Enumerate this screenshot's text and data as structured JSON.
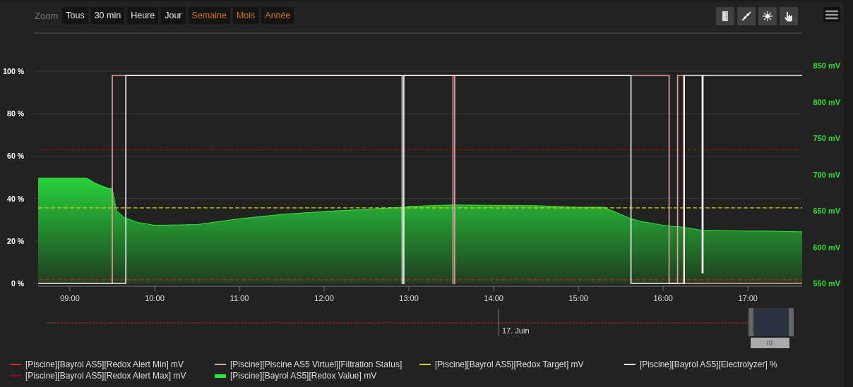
{
  "zoom": {
    "label": "Zoom",
    "buttons": [
      {
        "label": "Tous",
        "disabled": false
      },
      {
        "label": "30 min",
        "disabled": false
      },
      {
        "label": "Heure",
        "disabled": false
      },
      {
        "label": "Jour",
        "disabled": false
      },
      {
        "label": "Semaine",
        "disabled": true
      },
      {
        "label": "Mois",
        "disabled": true
      },
      {
        "label": "Année",
        "disabled": true
      }
    ]
  },
  "tools": [
    {
      "kind": "ruler"
    },
    {
      "kind": "line"
    },
    {
      "kind": "asterisk"
    },
    {
      "kind": "hand"
    }
  ],
  "chart": {
    "chart_data": {
      "type": "line",
      "grid": true,
      "x": [
        8.625,
        9.2,
        9.3,
        9.45,
        9.5,
        9.5,
        9.55,
        9.65,
        9.66,
        9.66,
        9.8,
        10,
        10.5,
        11,
        11.5,
        12,
        12.5,
        12.92,
        12.92,
        12.94,
        12.94,
        13,
        13.5,
        13.52,
        13.52,
        13.54,
        13.54,
        14.5,
        15,
        15.3,
        15.5,
        15.62,
        15.62,
        15.75,
        16,
        16.07,
        16.07,
        16.17,
        16.17,
        16.2,
        16.24,
        16.24,
        16.25,
        16.25,
        16.46,
        16.46,
        16.47,
        16.47,
        16.5,
        17,
        17.2,
        17.64
      ],
      "xlim": [
        8.625,
        17.64
      ],
      "xticks": [
        {
          "value": 9,
          "label": "09:00"
        },
        {
          "value": 10,
          "label": "10:00"
        },
        {
          "value": 11,
          "label": "11:00"
        },
        {
          "value": 12,
          "label": "12:00"
        },
        {
          "value": 13,
          "label": "13:00"
        },
        {
          "value": 14,
          "label": "14:00"
        },
        {
          "value": 15,
          "label": "15:00"
        },
        {
          "value": 16,
          "label": "16:00"
        },
        {
          "value": 17,
          "label": "17:00"
        }
      ],
      "ylim": [
        0,
        100
      ],
      "yticks": [
        {
          "value": 0,
          "label": "0 %"
        },
        {
          "value": 20,
          "label": "20 %"
        },
        {
          "value": 40,
          "label": "40 %"
        },
        {
          "value": 60,
          "label": "60 %"
        },
        {
          "value": 80,
          "label": "80 %"
        },
        {
          "value": 100,
          "label": "100 %"
        }
      ],
      "y2lim": [
        550,
        850
      ],
      "y2ticks": [
        {
          "value": 550,
          "label": "550 mV"
        },
        {
          "value": 600,
          "label": "600 mV"
        },
        {
          "value": 650,
          "label": "650 mV"
        },
        {
          "value": 700,
          "label": "700 mV"
        },
        {
          "value": 750,
          "label": "750 mV"
        },
        {
          "value": 800,
          "label": "800 mV"
        },
        {
          "value": 850,
          "label": "850 mV"
        }
      ],
      "series": [
        {
          "name": "[Piscine][Bayrol AS5][Redox Alert Min] mV",
          "color": "#c8281e",
          "type": "line",
          "line_style": "dashed",
          "axis": "y2",
          "values": [
            555,
            555,
            555,
            555,
            555,
            555,
            555,
            555,
            555,
            555,
            555,
            555,
            555,
            555,
            555,
            555,
            555,
            555,
            555,
            555,
            555,
            555,
            555,
            555,
            555,
            555,
            555,
            555,
            555,
            555,
            555,
            555,
            555,
            555,
            555,
            555,
            555,
            555,
            555,
            555,
            555,
            555,
            555,
            555,
            555,
            555,
            555,
            555,
            555,
            555,
            555,
            555
          ]
        },
        {
          "name": "[Piscine][Piscine AS5 Virtuel][Filtration Status]",
          "color": "#e8a3a0",
          "type": "line",
          "line_style": "solid",
          "values": [
            null,
            null,
            null,
            null,
            0,
            98,
            98,
            98,
            98,
            98,
            98,
            98,
            98,
            98,
            98,
            98,
            98,
            98,
            98,
            98,
            98,
            98,
            98,
            98,
            0,
            0,
            98,
            98,
            98,
            98,
            98,
            98,
            98,
            98,
            98,
            98,
            0,
            0,
            98,
            98,
            98,
            0,
            0,
            0,
            0,
            0,
            0,
            0,
            0,
            0,
            0,
            0
          ]
        },
        {
          "name": "[Piscine][Bayrol AS5][Redox Target] mV",
          "color": "#d4d400",
          "type": "line",
          "line_style": "dashed",
          "axis": "y2",
          "values": [
            654,
            654,
            654,
            654,
            654,
            654,
            654,
            654,
            654,
            654,
            654,
            654,
            654,
            654,
            654,
            654,
            654,
            654,
            654,
            654,
            654,
            654,
            654,
            654,
            654,
            654,
            654,
            654,
            654,
            654,
            654,
            654,
            654,
            654,
            654,
            654,
            654,
            654,
            654,
            654,
            654,
            654,
            654,
            654,
            654,
            654,
            654,
            654,
            654,
            654,
            654,
            654
          ]
        },
        {
          "name": "[Piscine][Bayrol AS5][Electrolyzer] %",
          "color": "#f2f2f2",
          "type": "line",
          "line_style": "solid",
          "values": [
            0,
            0,
            0,
            0,
            0,
            0,
            0,
            0,
            0,
            98,
            98,
            98,
            98,
            98,
            98,
            98,
            98,
            98,
            0,
            0,
            98,
            98,
            98,
            98,
            98,
            98,
            98,
            98,
            98,
            98,
            98,
            98,
            0,
            0,
            0,
            0,
            0,
            0,
            0,
            0,
            0,
            0,
            0,
            98,
            98,
            5,
            5,
            98,
            98,
            98,
            98,
            98
          ]
        },
        {
          "name": "[Piscine][Bayrol AS5][Redox Alert Max] mV",
          "color": "#a80000",
          "type": "line",
          "line_style": "dashed",
          "axis": "y2",
          "values": [
            734,
            734,
            734,
            734,
            734,
            734,
            734,
            734,
            734,
            734,
            734,
            734,
            734,
            734,
            734,
            734,
            734,
            734,
            734,
            734,
            734,
            734,
            734,
            734,
            734,
            734,
            734,
            734,
            734,
            734,
            734,
            734,
            734,
            734,
            734,
            734,
            734,
            734,
            734,
            734,
            734,
            734,
            734,
            734,
            734,
            734,
            734,
            734,
            734,
            734,
            734,
            734
          ]
        },
        {
          "name": "[Piscine][Bayrol AS5][Redox Value] mV",
          "color": "#2ee83c",
          "type": "area",
          "axis": "y2",
          "values": [
            695,
            695,
            688,
            681,
            680,
            680,
            650,
            640,
            640,
            640,
            634,
            630,
            631,
            639,
            645,
            649,
            652,
            655,
            655,
            655,
            655,
            656,
            658,
            658,
            658,
            658,
            658,
            657,
            655,
            655,
            645,
            639,
            639,
            635,
            630,
            629,
            629,
            628,
            628,
            628,
            627,
            627,
            627,
            627,
            623,
            623,
            623,
            623,
            623,
            622,
            622,
            621
          ]
        }
      ]
    }
  },
  "navigator": {
    "date_label": "17. Juin"
  }
}
